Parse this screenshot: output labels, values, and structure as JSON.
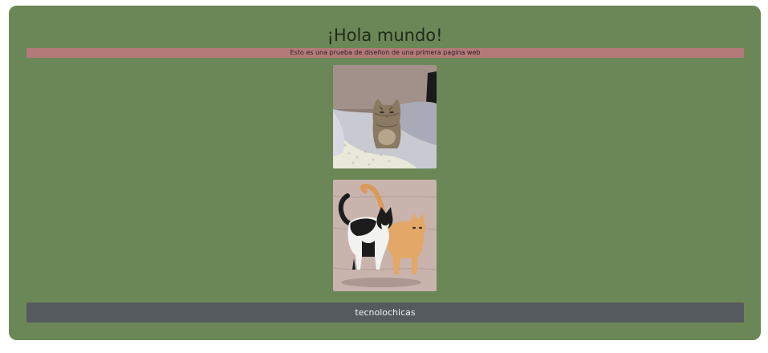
{
  "header": {
    "title": "¡Hola mundo!",
    "subtitle": "Esto es una prueba de diseñon de una primera pagina web"
  },
  "images": [
    {
      "name": "kitten-on-bed"
    },
    {
      "name": "two-cats-walking"
    }
  ],
  "footer": {
    "text": "tecnolochicas"
  },
  "colors": {
    "page_background": "#6b8757",
    "subtitle_bar": "#b37a7a",
    "footer_bar": "#555a5f"
  }
}
